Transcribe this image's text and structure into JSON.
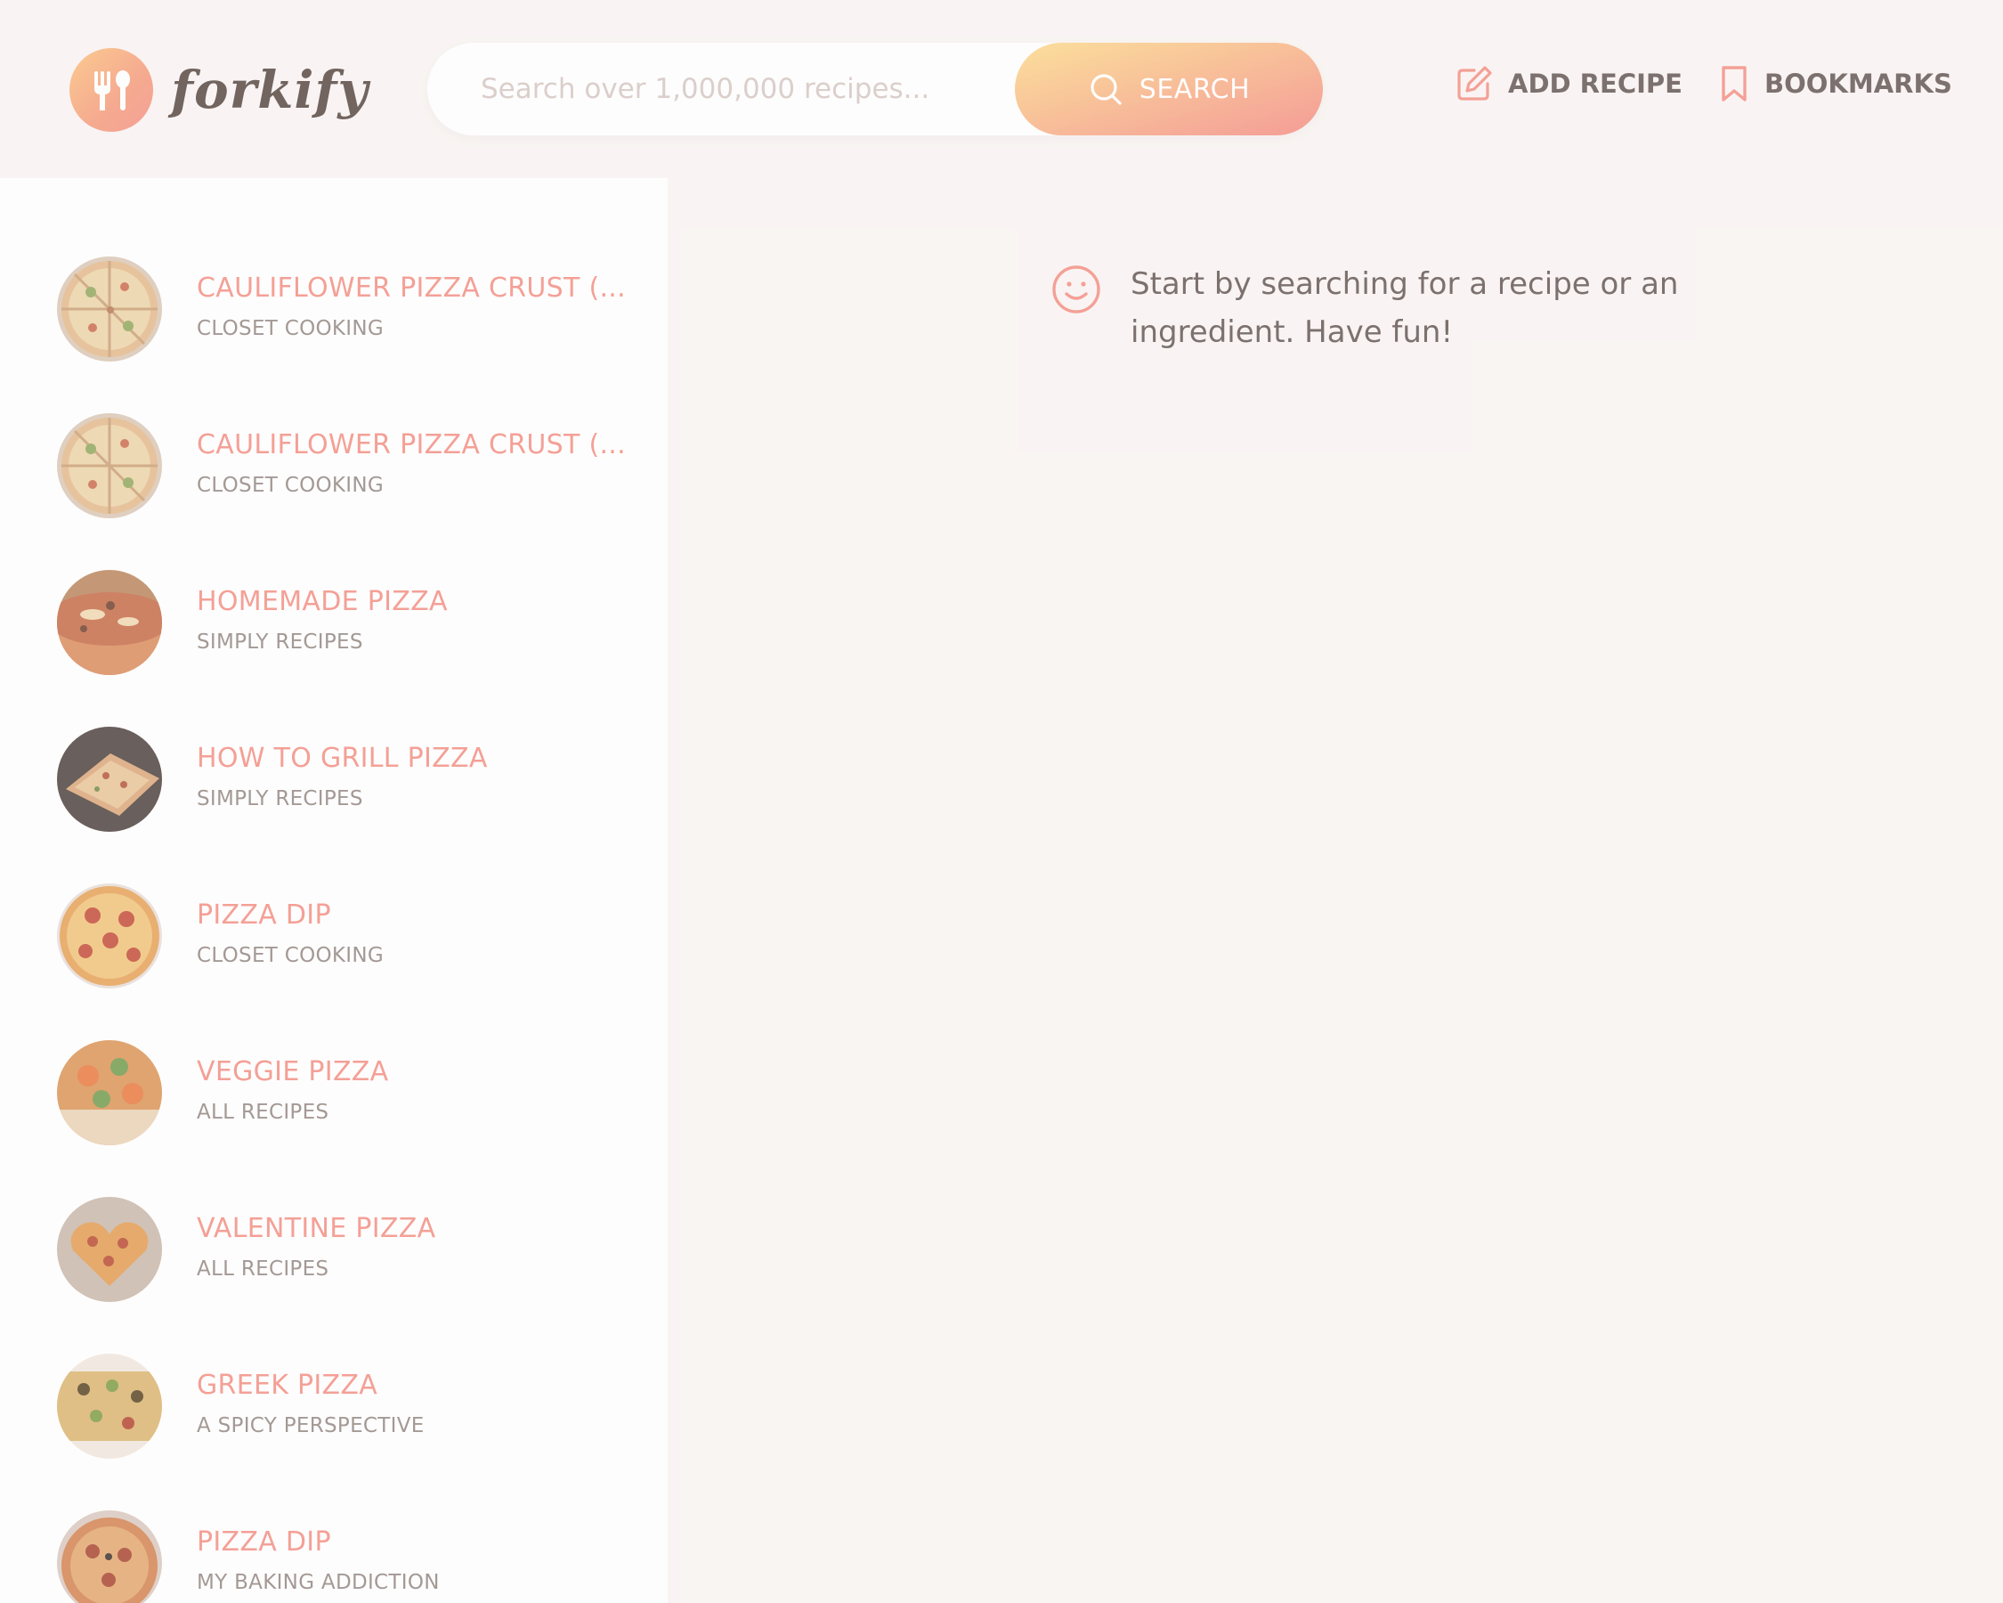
{
  "header": {
    "logo_text": "forkify",
    "search": {
      "placeholder": "Search over 1,000,000 recipes...",
      "value": "",
      "button_label": "SEARCH"
    },
    "nav": {
      "add_recipe_label": "ADD RECIPE",
      "bookmarks_label": "BOOKMARKS"
    }
  },
  "results": [
    {
      "title": "CAULIFLOWER PIZZA CRUST (...",
      "publisher": "CLOSET COOKING",
      "thumb": "pizza-slices"
    },
    {
      "title": "CAULIFLOWER PIZZA CRUST (...",
      "publisher": "CLOSET COOKING",
      "thumb": "pizza-slices"
    },
    {
      "title": "HOMEMADE PIZZA",
      "publisher": "SIMPLY RECIPES",
      "thumb": "pizza-closeup"
    },
    {
      "title": "HOW TO GRILL PIZZA",
      "publisher": "SIMPLY RECIPES",
      "thumb": "grilled-pizza"
    },
    {
      "title": "PIZZA DIP",
      "publisher": "CLOSET COOKING",
      "thumb": "pepperoni-pizza"
    },
    {
      "title": "VEGGIE PIZZA",
      "publisher": "ALL RECIPES",
      "thumb": "veggie-pizza"
    },
    {
      "title": "VALENTINE PIZZA",
      "publisher": "ALL RECIPES",
      "thumb": "heart-pizza"
    },
    {
      "title": "GREEK PIZZA",
      "publisher": "A SPICY PERSPECTIVE",
      "thumb": "greek-pizza"
    },
    {
      "title": "PIZZA DIP",
      "publisher": "MY BAKING ADDICTION",
      "thumb": "pizza-dip"
    }
  ],
  "message": {
    "icon": "smile-icon",
    "text": "Start by searching for a recipe or an ingredient. Have fun!"
  },
  "colors": {
    "accent": "#f38e82",
    "gradient_start": "#fbdb89",
    "gradient_end": "#f48982",
    "text_dark": "#615551",
    "text_muted": "#918581",
    "background": "#f9f5f3"
  }
}
